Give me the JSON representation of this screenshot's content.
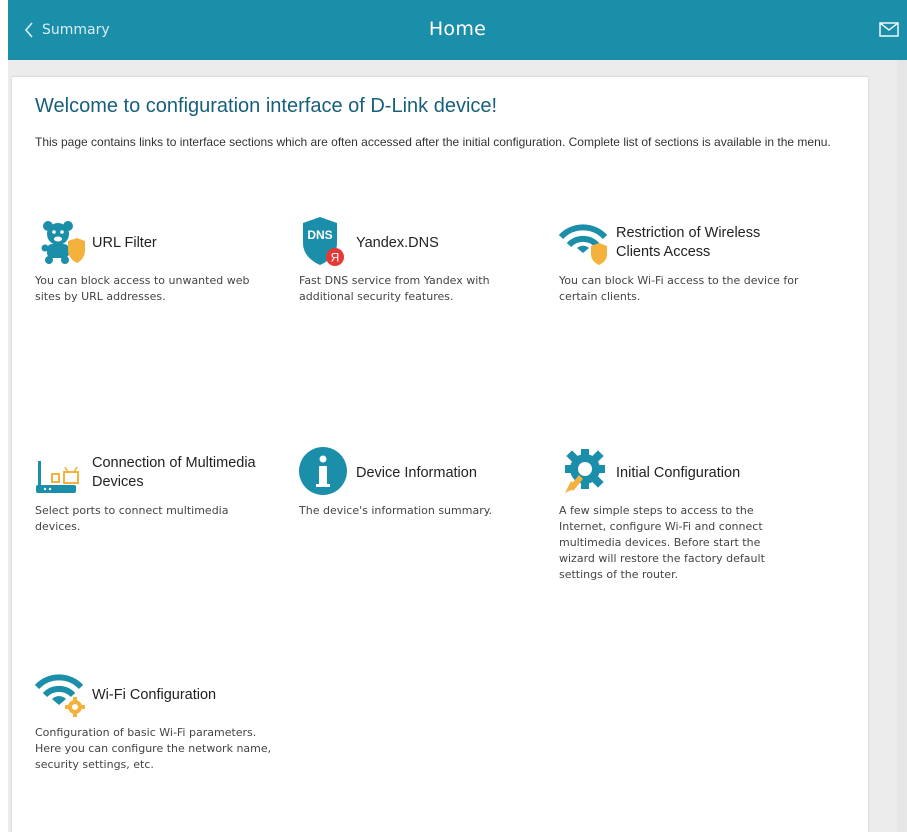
{
  "header": {
    "back_label": "Summary",
    "title": "Home",
    "accent_color": "#1b8eaa"
  },
  "main": {
    "welcome": "Welcome to configuration interface of D-Link device!",
    "intro": "This page contains links to interface sections which are often accessed after the initial configuration. Complete list of sections is available in the menu."
  },
  "tiles": [
    {
      "name": "URL Filter",
      "desc": "You can block access to unwanted web sites by URL addresses.",
      "icon": "url-filter-icon"
    },
    {
      "name": "Yandex.DNS",
      "desc": "Fast DNS service from Yandex with additional security features.",
      "icon": "yandex-dns-icon",
      "icon_text": "DNS",
      "badge_text": "Я"
    },
    {
      "name": "Restriction of Wireless Clients Access",
      "desc": "You can block Wi-Fi access to the device for certain clients.",
      "icon": "wireless-restriction-icon"
    },
    {
      "name": "Connection of Multimedia Devices",
      "desc": "Select ports to connect multimedia devices.",
      "icon": "multimedia-devices-icon"
    },
    {
      "name": "Device Information",
      "desc": "The device's information summary.",
      "icon": "device-info-icon"
    },
    {
      "name": "Initial Configuration",
      "desc": "A few simple steps to access to the Internet, configure Wi-Fi and connect multimedia devices. Before start the wizard will restore the factory default settings of the router.",
      "icon": "initial-configuration-icon"
    },
    {
      "name": "Wi-Fi Configuration",
      "desc": "Configuration of basic Wi-Fi parameters. Here you can configure the network name, security settings, etc.",
      "icon": "wifi-configuration-icon"
    }
  ]
}
